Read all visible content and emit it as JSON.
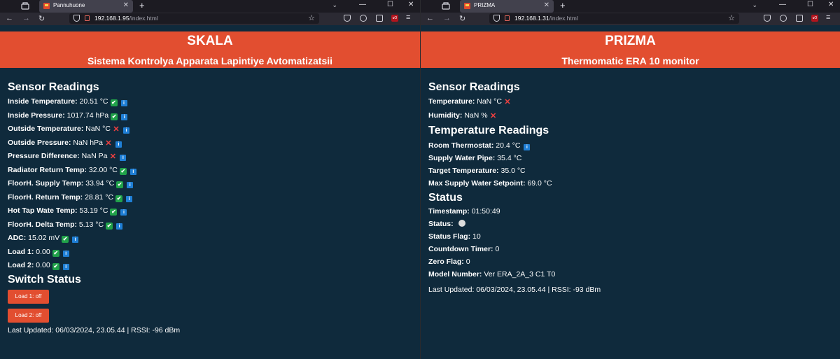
{
  "left": {
    "tab_title": "Pannuhuone",
    "url_host": "192.168.1.95",
    "url_path": "/index.html",
    "header_title": "SKALA",
    "header_subtitle": "Sistema Kontrolya Apparata Lapintiye Avtomatizatsii",
    "sensor_heading": "Sensor Readings",
    "sensors": [
      {
        "label": "Inside Temperature:",
        "value": "20.51 °C",
        "status": "ok"
      },
      {
        "label": "Inside Pressure:",
        "value": "1017.74 hPa",
        "status": "ok"
      },
      {
        "label": "Outside Temperature:",
        "value": "NaN °C",
        "status": "error"
      },
      {
        "label": "Outside Pressure:",
        "value": "NaN hPa",
        "status": "error"
      },
      {
        "label": "Pressure Difference:",
        "value": "NaN Pa",
        "status": "error"
      },
      {
        "label": "Radiator Return Temp:",
        "value": "32.00 °C",
        "status": "ok"
      },
      {
        "label": "FloorH. Supply Temp:",
        "value": "33.94 °C",
        "status": "ok"
      },
      {
        "label": "FloorH. Return Temp:",
        "value": "28.81 °C",
        "status": "ok"
      },
      {
        "label": "Hot Tap Wate Temp:",
        "value": "53.19 °C",
        "status": "ok"
      },
      {
        "label": "FloorH. Delta Temp:",
        "value": "5.13 °C",
        "status": "ok"
      },
      {
        "label": "ADC:",
        "value": "15.02 mV",
        "status": "ok"
      },
      {
        "label": "Load 1:",
        "value": "0.00",
        "status": "ok"
      },
      {
        "label": "Load 2:",
        "value": "0.00",
        "status": "ok"
      }
    ],
    "switch_heading": "Switch Status",
    "buttons": [
      "Load 1: off",
      "Load 2: off"
    ],
    "footer": "Last Updated: 06/03/2024, 23.05.44 | RSSI: -96 dBm"
  },
  "right": {
    "tab_title": "PRIZMA",
    "url_host": "192.168.1.31",
    "url_path": "/index.html",
    "header_title": "PRIZMA",
    "header_subtitle": "Thermomatic ERA 10 monitor",
    "sensor_heading": "Sensor Readings",
    "sensors": [
      {
        "label": "Temperature:",
        "value": "NaN °C",
        "status": "error"
      },
      {
        "label": "Humidity:",
        "value": "NaN %",
        "status": "error"
      }
    ],
    "temp_heading": "Temperature Readings",
    "temps": [
      {
        "label": "Room Thermostat:",
        "value": "20.4 °C",
        "info": true
      },
      {
        "label": "Supply Water Pipe:",
        "value": "35.4 °C",
        "info": false
      },
      {
        "label": "Target Temperature:",
        "value": "35.0 °C",
        "info": false
      },
      {
        "label": "Max Supply Water Setpoint:",
        "value": "69.0 °C",
        "info": false
      }
    ],
    "status_heading": "Status",
    "status": [
      {
        "label": "Timestamp:",
        "value": "01:50:49"
      },
      {
        "label": "Status:",
        "value": ""
      },
      {
        "label": "Status Flag:",
        "value": "10"
      },
      {
        "label": "Countdown Timer:",
        "value": "0"
      },
      {
        "label": "Zero Flag:",
        "value": "0"
      },
      {
        "label": "Model Number:",
        "value": "Ver ERA_2A_3 C1 T0"
      }
    ],
    "footer": "Last Updated: 06/03/2024, 23.05.44 | RSSI: -93 dBm"
  },
  "icons": {
    "ok": "✔",
    "error": "✕",
    "info": "i"
  },
  "colors": {
    "accent": "#e24e30",
    "page_bg": "#0f2a3c",
    "ok": "#21a24a",
    "error": "#f04040",
    "info": "#1f7fd6"
  }
}
